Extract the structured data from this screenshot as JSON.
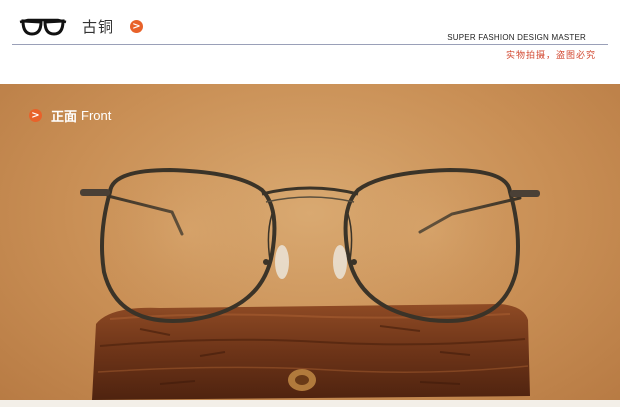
{
  "header": {
    "icon": "glasses-icon",
    "color_name": "古铜",
    "arrow": ">",
    "brand": "SUPER FASHION DESIGN MASTER",
    "tagline": "实物拍摄，盗图必究"
  },
  "photo": {
    "arrow": ">",
    "label_cn": "正面",
    "label_en": "Front"
  },
  "colors": {
    "accent": "#e8622a",
    "tagline": "#d2462e",
    "frame": "#3a3328",
    "background": "#c98f55",
    "wood": "#7a3e1e"
  }
}
